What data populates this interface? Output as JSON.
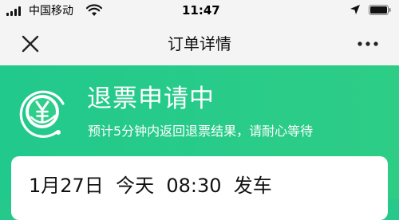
{
  "status_bar": {
    "carrier": "中国移动",
    "time": "11:47"
  },
  "nav": {
    "title": "订单详情",
    "close_icon": "close-icon",
    "more_icon": "more-dots-icon"
  },
  "refund": {
    "title": "退票申请中",
    "subtitle": "预计5分钟内返回退票结果，请耐心等待",
    "icon": "refund-yuan-icon"
  },
  "trip": {
    "departure_text": "1月27日  今天  08:30  发车"
  },
  "colors": {
    "accent_green": "#26c98b",
    "header_bg": "#f4f4f4",
    "card_bg": "#ffffff"
  }
}
